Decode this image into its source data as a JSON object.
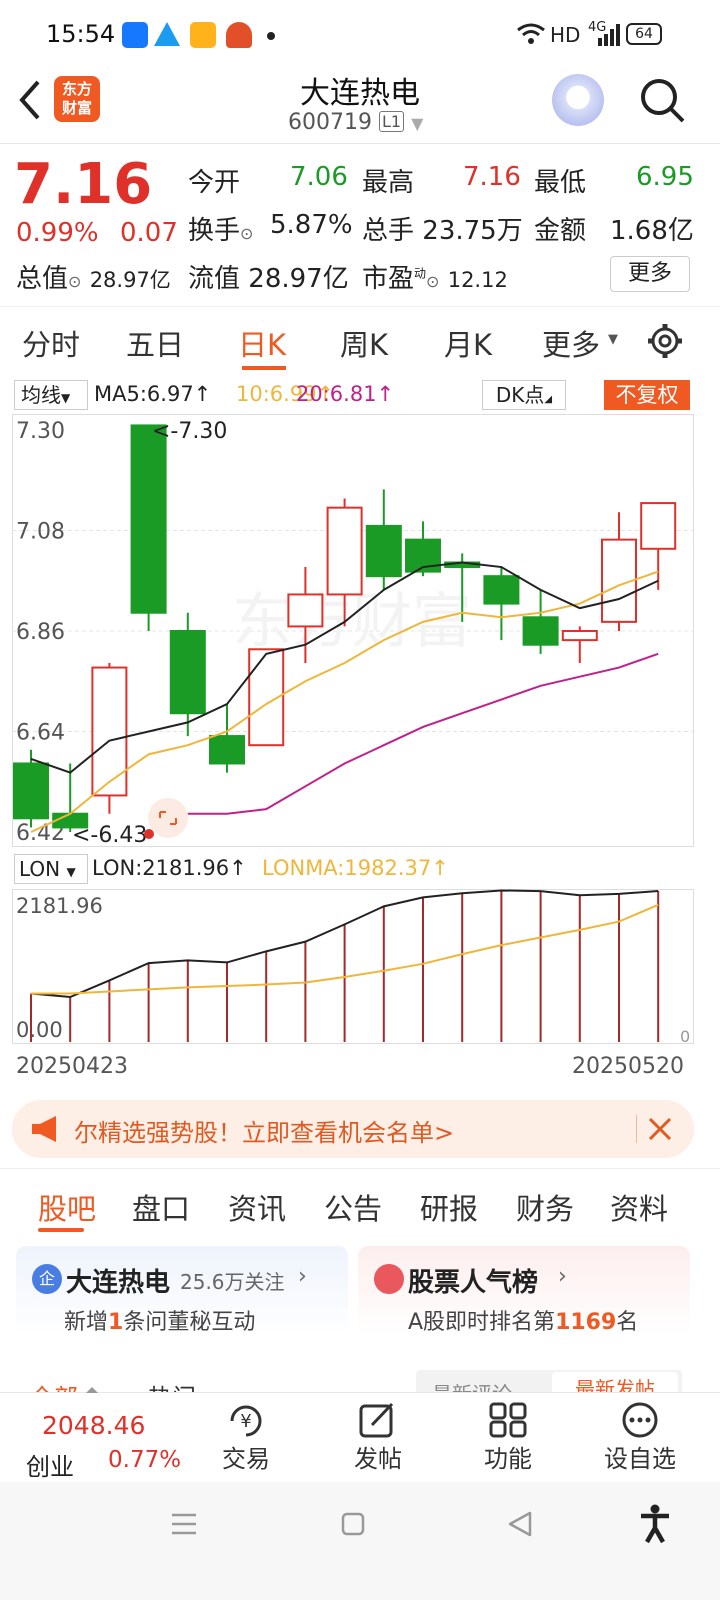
{
  "status": {
    "time": "15:54",
    "network": "HD",
    "signal": "4G",
    "battery": "64"
  },
  "header": {
    "logo_line1": "东方",
    "logo_line2": "财富",
    "title": "大连热电",
    "code": "600719",
    "market_badge": "L1"
  },
  "quote": {
    "price": "7.16",
    "change_pct": "0.99%",
    "change": "0.07",
    "open_label": "今开",
    "open": "7.06",
    "high_label": "最高",
    "high": "7.16",
    "low_label": "最低",
    "low": "6.95",
    "turnover_label": "换手",
    "turnover": "5.87%",
    "volume_label": "总手",
    "volume": "23.75万",
    "amount_label": "金额",
    "amount": "1.68亿",
    "mktcap_label": "总值",
    "mktcap": "28.97亿",
    "float_label": "流值",
    "float": "28.97亿",
    "pe_label": "市盈",
    "pe_sup": "动",
    "pe": "12.12",
    "more_label": "更多"
  },
  "period_tabs": [
    "分时",
    "五日",
    "日K",
    "周K",
    "月K",
    "更多"
  ],
  "active_tab": "日K",
  "indicators": {
    "ma_select": "均线",
    "ma5": "MA5:6.97↑",
    "ma10": "10:6.99↑",
    "ma20": "20:6.81↑",
    "dk": "DK点",
    "fq": "不复权",
    "lon_select": "LON",
    "lon": "LON:2181.96↑",
    "lonma": "LONMA:1982.37↑"
  },
  "colors": {
    "up": "#e0302a",
    "down": "#1a9b25",
    "ma5": "#222222",
    "ma10": "#f0b63a",
    "ma20": "#c0208a",
    "accent": "#f05a22"
  },
  "chart_data": {
    "type": "candlestick",
    "ylim": [
      6.42,
      7.3
    ],
    "yticks": [
      "7.30",
      "7.08",
      "6.86",
      "6.64",
      "6.42"
    ],
    "max_label": "<-7.30",
    "min_label": "<-6.43",
    "candles": [
      {
        "o": 6.57,
        "c": 6.45,
        "h": 6.6,
        "l": 6.43
      },
      {
        "o": 6.46,
        "c": 6.43,
        "h": 6.57,
        "l": 6.42
      },
      {
        "o": 6.5,
        "c": 6.78,
        "h": 6.79,
        "l": 6.46
      },
      {
        "o": 7.31,
        "c": 6.9,
        "h": 7.31,
        "l": 6.86
      },
      {
        "o": 6.86,
        "c": 6.68,
        "h": 6.9,
        "l": 6.63
      },
      {
        "o": 6.63,
        "c": 6.57,
        "h": 6.7,
        "l": 6.55
      },
      {
        "o": 6.61,
        "c": 6.82,
        "h": 6.82,
        "l": 6.61
      },
      {
        "o": 6.87,
        "c": 6.94,
        "h": 7.0,
        "l": 6.79
      },
      {
        "o": 6.94,
        "c": 7.13,
        "h": 7.15,
        "l": 6.87
      },
      {
        "o": 7.09,
        "c": 6.98,
        "h": 7.17,
        "l": 6.95
      },
      {
        "o": 7.06,
        "c": 6.99,
        "h": 7.1,
        "l": 6.98
      },
      {
        "o": 7.01,
        "c": 7.0,
        "h": 7.03,
        "l": 6.88
      },
      {
        "o": 6.98,
        "c": 6.92,
        "h": 7.0,
        "l": 6.84
      },
      {
        "o": 6.89,
        "c": 6.83,
        "h": 6.95,
        "l": 6.81
      },
      {
        "o": 6.84,
        "c": 6.86,
        "h": 6.87,
        "l": 6.79
      },
      {
        "o": 6.88,
        "c": 7.06,
        "h": 7.12,
        "l": 6.86
      },
      {
        "o": 7.04,
        "c": 7.14,
        "h": 7.14,
        "l": 6.95
      }
    ],
    "ma5": [
      6.58,
      6.55,
      6.62,
      6.64,
      6.66,
      6.7,
      6.81,
      6.83,
      6.88,
      6.95,
      7.0,
      7.01,
      7.0,
      6.95,
      6.91,
      6.93,
      6.97
    ],
    "ma10": [
      6.42,
      6.46,
      6.53,
      6.59,
      6.61,
      6.64,
      6.7,
      6.75,
      6.79,
      6.84,
      6.88,
      6.9,
      6.89,
      6.9,
      6.92,
      6.96,
      6.99
    ],
    "ma20": [
      null,
      null,
      null,
      null,
      6.46,
      6.46,
      6.47,
      6.52,
      6.57,
      6.61,
      6.65,
      6.68,
      6.71,
      6.74,
      6.76,
      6.78,
      6.81
    ],
    "lon": {
      "ylim": [
        0,
        2181.96
      ],
      "top_label": "2181.96",
      "bottom_label": "0.00",
      "right_label": "0",
      "lon": [
        700,
        650,
        890,
        1140,
        1180,
        1150,
        1310,
        1450,
        1700,
        1960,
        2090,
        2150,
        2190,
        2180,
        2120,
        2140,
        2181.96
      ],
      "lonma": [
        700,
        700,
        730,
        760,
        790,
        810,
        830,
        860,
        940,
        1030,
        1130,
        1270,
        1400,
        1510,
        1620,
        1740,
        1982.37
      ]
    },
    "start_date": "20250423",
    "end_date": "20250520"
  },
  "watermark": "东方财富",
  "banner": {
    "text": "尔精选强势股！立即查看机会名单>"
  },
  "bottom_tabs": [
    "股吧",
    "盘口",
    "资讯",
    "公告",
    "研报",
    "财务",
    "资料"
  ],
  "active_bottom_tab": "股吧",
  "cards": {
    "left": {
      "badge": "企",
      "title": "大连热电",
      "follow": "25.6万关注",
      "sub_pre": "新增",
      "sub_num": "1",
      "sub_post": "条问董秘互动"
    },
    "right": {
      "title": "股票人气榜",
      "sub_pre": "A股即时排名第",
      "sub_num": "1169",
      "sub_post": "名"
    }
  },
  "sort_tabs": {
    "all": "全部",
    "hot": "热门",
    "latest_comment": "最新评论",
    "latest_post": "最新发帖"
  },
  "bottom_bar": {
    "index_value": "2048.46",
    "index_name": "创业",
    "index_change": "0.77%",
    "trade": "交易",
    "post": "发帖",
    "functions": "功能",
    "watchlist": "设自选"
  }
}
